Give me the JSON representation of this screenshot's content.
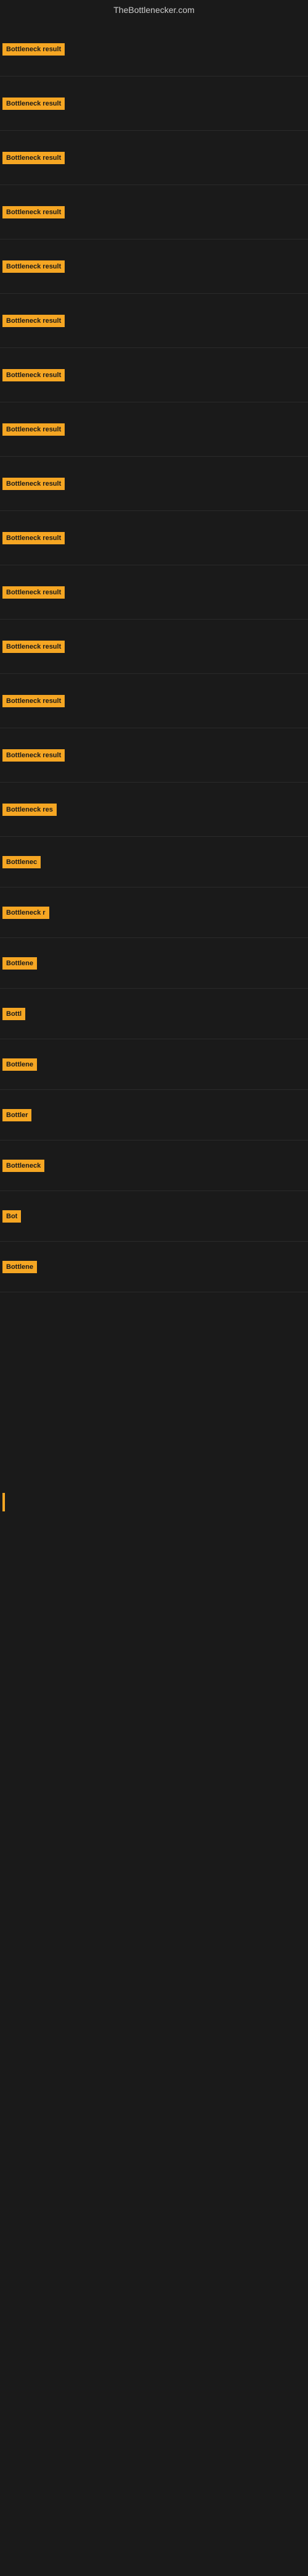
{
  "site": {
    "title": "TheBottlenecker.com"
  },
  "items": [
    {
      "label": "Bottleneck result",
      "size": "full",
      "height": 88
    },
    {
      "label": "Bottleneck result",
      "size": "full",
      "height": 88
    },
    {
      "label": "Bottleneck result",
      "size": "full",
      "height": 88
    },
    {
      "label": "Bottleneck result",
      "size": "full",
      "height": 88
    },
    {
      "label": "Bottleneck result",
      "size": "full",
      "height": 88
    },
    {
      "label": "Bottleneck result",
      "size": "full",
      "height": 88
    },
    {
      "label": "Bottleneck result",
      "size": "full",
      "height": 88
    },
    {
      "label": "Bottleneck result",
      "size": "full",
      "height": 88
    },
    {
      "label": "Bottleneck result",
      "size": "full",
      "height": 88
    },
    {
      "label": "Bottleneck result",
      "size": "full",
      "height": 88
    },
    {
      "label": "Bottleneck result",
      "size": "full",
      "height": 88
    },
    {
      "label": "Bottleneck result",
      "size": "full",
      "height": 88
    },
    {
      "label": "Bottleneck result",
      "size": "full",
      "height": 88
    },
    {
      "label": "Bottleneck result",
      "size": "full",
      "height": 88
    },
    {
      "label": "Bottleneck res",
      "size": "lg",
      "height": 88
    },
    {
      "label": "Bottlenec",
      "size": "md",
      "height": 82
    },
    {
      "label": "Bottleneck r",
      "size": "lg",
      "height": 82
    },
    {
      "label": "Bottlene",
      "size": "md",
      "height": 82
    },
    {
      "label": "Bottl",
      "size": "sm",
      "height": 82
    },
    {
      "label": "Bottlene",
      "size": "md",
      "height": 82
    },
    {
      "label": "Bottler",
      "size": "sm",
      "height": 82
    },
    {
      "label": "Bottleneck",
      "size": "md",
      "height": 82
    },
    {
      "label": "Bot",
      "size": "xs",
      "height": 82
    },
    {
      "label": "Bottlene",
      "size": "md",
      "height": 82
    }
  ],
  "colors": {
    "badge_bg": "#f5a623",
    "badge_text": "#1a1a1a",
    "background": "#1a1a1a",
    "title_text": "#cccccc"
  }
}
